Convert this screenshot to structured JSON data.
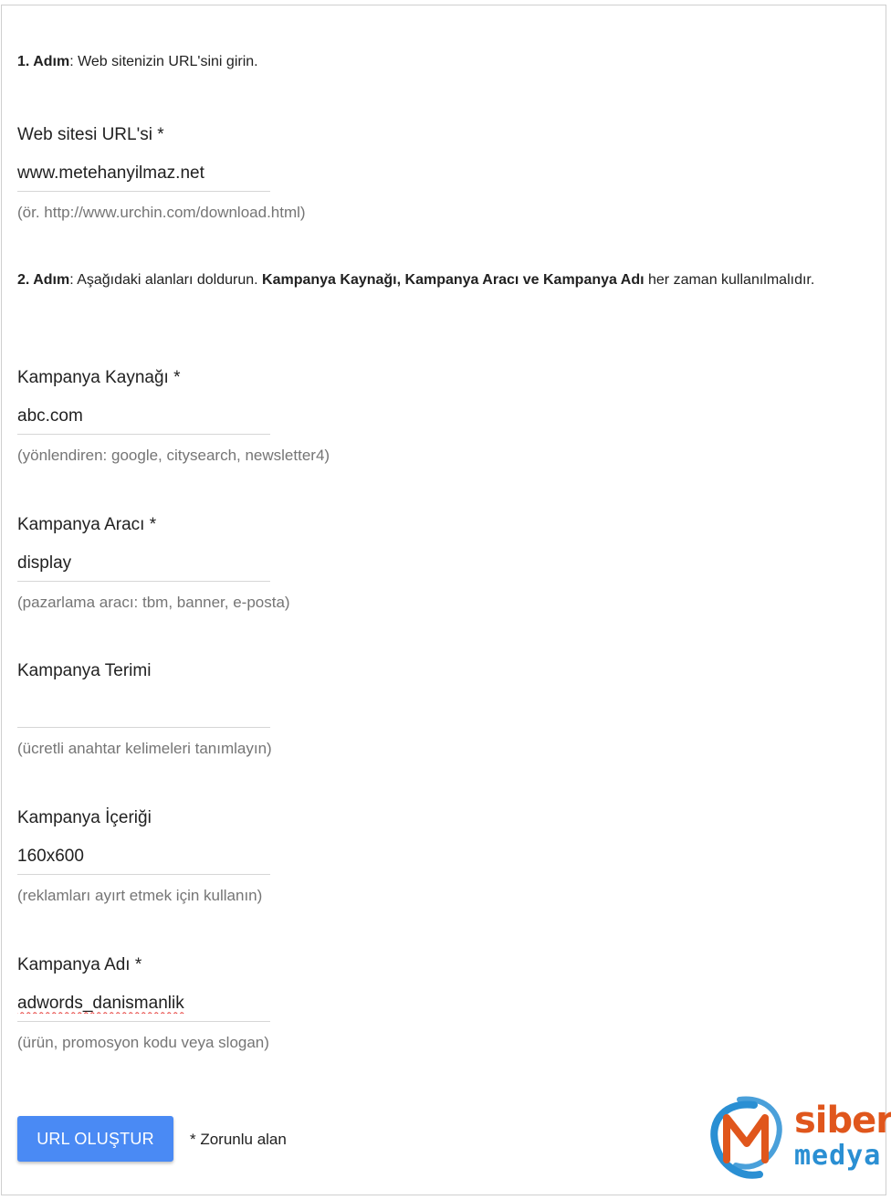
{
  "step1": {
    "step_label": "1. Adım",
    "text": ": Web sitenizin URL'sini girin."
  },
  "website_url": {
    "label": "Web sitesi URL'si *",
    "value": "www.metehanyilmaz.net",
    "hint": "(ör. http://www.urchin.com/download.html)"
  },
  "step2": {
    "step_label": "2. Adım",
    "text_before": ": Aşağıdaki alanları doldurun. ",
    "bold_fields": "Kampanya Kaynağı, Kampanya Aracı ve Kampanya Adı",
    "text_after": " her zaman kullanılmalıdır."
  },
  "fields": {
    "source": {
      "label": "Kampanya Kaynağı *",
      "value": "abc.com",
      "hint": "(yönlendiren: google, citysearch, newsletter4)"
    },
    "medium": {
      "label": "Kampanya Aracı *",
      "value": "display",
      "hint": "(pazarlama aracı: tbm, banner, e-posta)"
    },
    "term": {
      "label": "Kampanya Terimi",
      "value": "",
      "hint": "(ücretli anahtar kelimeleri tanımlayın)"
    },
    "content": {
      "label": "Kampanya İçeriği",
      "value": "160x600",
      "hint": "(reklamları ayırt etmek için kullanın)"
    },
    "name": {
      "label": "Kampanya Adı *",
      "value": "adwords_danismanlik",
      "hint": "(ürün, promosyon kodu veya slogan)"
    }
  },
  "submit_label": "URL OLUŞTUR",
  "required_note": "* Zorunlu alan",
  "logo": {
    "word1": "siber",
    "word2": "medya"
  },
  "colors": {
    "button": "#4a8af4",
    "logo_orange": "#e0561c",
    "logo_blue": "#2a8fd3"
  }
}
